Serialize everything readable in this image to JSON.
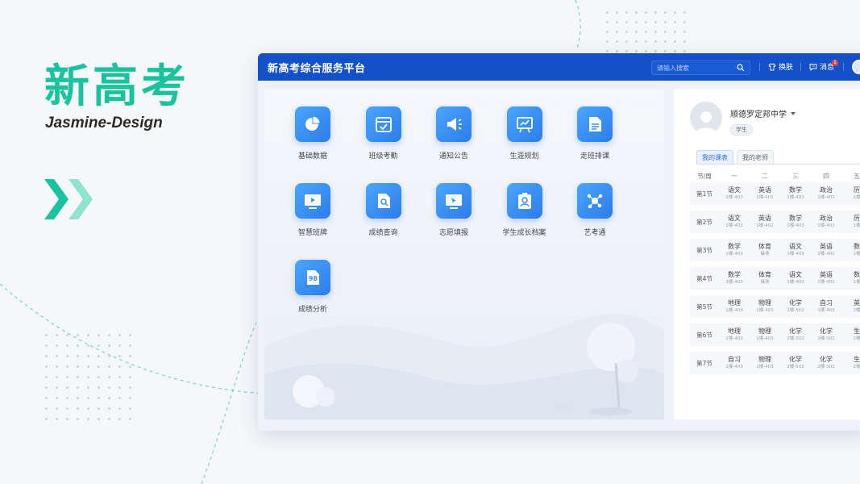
{
  "hero": {
    "title": "新高考",
    "subtitle": "Jasmine-Design"
  },
  "colors": {
    "brand_green": "#19c39d",
    "topbar_blue": "#1451c8",
    "icon_blue": "#2d7ce8",
    "badge_red": "#f04141"
  },
  "topbar": {
    "title": "新高考综合服务平台",
    "search_placeholder": "请输入搜索",
    "skin_label": "换肤",
    "message_label": "消息",
    "message_count": "1"
  },
  "apps": [
    {
      "label": "基础数据",
      "icon": "pie-chart-icon"
    },
    {
      "label": "班级考勤",
      "icon": "calendar-check-icon"
    },
    {
      "label": "通知公告",
      "icon": "megaphone-icon"
    },
    {
      "label": "生涯规划",
      "icon": "presentation-chart-icon"
    },
    {
      "label": "走班排课",
      "icon": "document-list-icon"
    },
    {
      "label": "智慧班牌",
      "icon": "monitor-play-icon"
    },
    {
      "label": "成绩查询",
      "icon": "document-search-icon"
    },
    {
      "label": "志愿填报",
      "icon": "monitor-cursor-icon"
    },
    {
      "label": "学生成长档案",
      "icon": "profile-board-icon"
    },
    {
      "label": "艺考通",
      "icon": "molecule-icon"
    },
    {
      "label": "成绩分析",
      "icon": "score-98-icon"
    }
  ],
  "profile": {
    "school": "顺德罗定邦中学",
    "role": "学生"
  },
  "tabs": [
    "我的课表",
    "我的老师"
  ],
  "timetable": {
    "header": [
      "节/周",
      "一",
      "二",
      "三",
      "四",
      "五"
    ],
    "rows": [
      {
        "period": "第1节",
        "cells": [
          [
            "语文",
            "1楼-403"
          ],
          [
            "英语",
            "1楼-402"
          ],
          [
            "数学",
            "1楼-403"
          ],
          [
            "政治",
            "1楼-402"
          ],
          [
            "历",
            "1楼"
          ]
        ]
      },
      {
        "period": "第2节",
        "cells": [
          [
            "语文",
            "1楼-403"
          ],
          [
            "英语",
            "1楼-402"
          ],
          [
            "数学",
            "1楼-403"
          ],
          [
            "政治",
            "1楼-402"
          ],
          [
            "历",
            "1楼"
          ]
        ]
      },
      {
        "period": "第3节",
        "cells": [
          [
            "数学",
            "1楼-403"
          ],
          [
            "体育",
            "操场"
          ],
          [
            "语文",
            "1楼-403"
          ],
          [
            "英语",
            "1楼-402"
          ],
          [
            "数",
            "1楼"
          ]
        ]
      },
      {
        "period": "第4节",
        "cells": [
          [
            "数学",
            "1楼-403"
          ],
          [
            "体育",
            "操场"
          ],
          [
            "语文",
            "1楼-403"
          ],
          [
            "英语",
            "1楼-402"
          ],
          [
            "数",
            "1楼"
          ]
        ]
      },
      {
        "period": "第5节",
        "cells": [
          [
            "地理",
            "1楼-403"
          ],
          [
            "物理",
            "1楼-403"
          ],
          [
            "化学",
            "2楼-502"
          ],
          [
            "自习",
            "1楼-403"
          ],
          [
            "英",
            "2楼"
          ]
        ]
      },
      {
        "period": "第6节",
        "cells": [
          [
            "地理",
            "1楼-403"
          ],
          [
            "物理",
            "1楼-403"
          ],
          [
            "化学",
            "2楼-502"
          ],
          [
            "化学",
            "2楼-502"
          ],
          [
            "生",
            "2楼"
          ]
        ]
      },
      {
        "period": "第7节",
        "cells": [
          [
            "自习",
            "1楼-403"
          ],
          [
            "物理",
            "1楼-403"
          ],
          [
            "化学",
            "2楼-502"
          ],
          [
            "化学",
            "2楼-502"
          ],
          [
            "生",
            "2楼"
          ]
        ]
      }
    ]
  }
}
